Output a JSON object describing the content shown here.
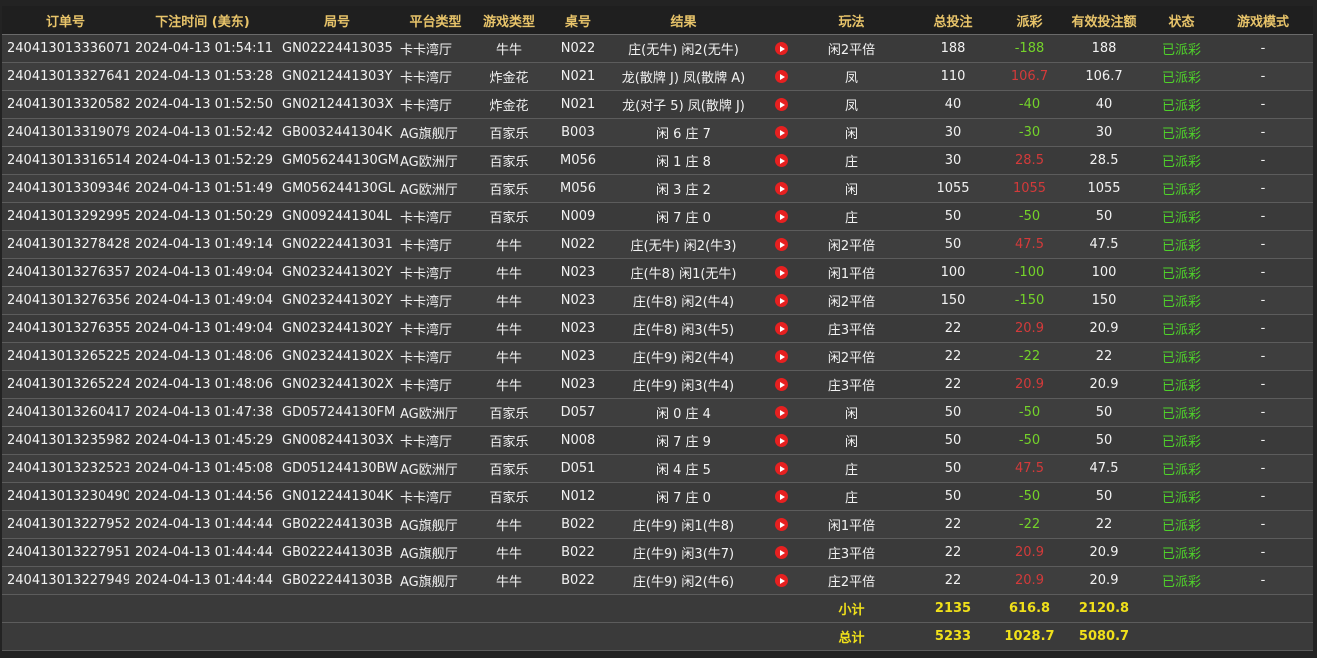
{
  "headers": [
    "订单号",
    "下注时间 (美东)",
    "局号",
    "平台类型",
    "游戏类型",
    "桌号",
    "结果",
    "玩法",
    "总投注",
    "派彩",
    "有效投注额",
    "状态",
    "游戏模式"
  ],
  "rows": [
    {
      "order": "240413013336071",
      "time": "2024-04-13 01:54:11",
      "round": "GN02224413035",
      "platform": "卡卡湾厅",
      "game": "牛牛",
      "table": "N022",
      "result": "庄(无牛) 闲2(无牛)",
      "play": "闲2平倍",
      "bet": "188",
      "payout": "-188",
      "payout_sign": "neg",
      "valid": "188",
      "status": "已派彩",
      "mode": "-"
    },
    {
      "order": "240413013327641",
      "time": "2024-04-13 01:53:28",
      "round": "GN0212441303Y",
      "platform": "卡卡湾厅",
      "game": "炸金花",
      "table": "N021",
      "result": "龙(散牌 J) 凤(散牌 A)",
      "play": "凤",
      "bet": "110",
      "payout": "106.7",
      "payout_sign": "pos",
      "valid": "106.7",
      "status": "已派彩",
      "mode": "-"
    },
    {
      "order": "240413013320582",
      "time": "2024-04-13 01:52:50",
      "round": "GN0212441303X",
      "platform": "卡卡湾厅",
      "game": "炸金花",
      "table": "N021",
      "result": "龙(对子 5) 凤(散牌 J)",
      "play": "凤",
      "bet": "40",
      "payout": "-40",
      "payout_sign": "neg",
      "valid": "40",
      "status": "已派彩",
      "mode": "-"
    },
    {
      "order": "240413013319079",
      "time": "2024-04-13 01:52:42",
      "round": "GB0032441304K",
      "platform": "AG旗舰厅",
      "game": "百家乐",
      "table": "B003",
      "result": "闲 6 庄 7",
      "play": "闲",
      "bet": "30",
      "payout": "-30",
      "payout_sign": "neg",
      "valid": "30",
      "status": "已派彩",
      "mode": "-"
    },
    {
      "order": "240413013316514",
      "time": "2024-04-13 01:52:29",
      "round": "GM056244130GM",
      "platform": "AG欧洲厅",
      "game": "百家乐",
      "table": "M056",
      "result": "闲 1 庄 8",
      "play": "庄",
      "bet": "30",
      "payout": "28.5",
      "payout_sign": "pos",
      "valid": "28.5",
      "status": "已派彩",
      "mode": "-"
    },
    {
      "order": "240413013309346",
      "time": "2024-04-13 01:51:49",
      "round": "GM056244130GL",
      "platform": "AG欧洲厅",
      "game": "百家乐",
      "table": "M056",
      "result": "闲 3 庄 2",
      "play": "闲",
      "bet": "1055",
      "payout": "1055",
      "payout_sign": "pos",
      "valid": "1055",
      "status": "已派彩",
      "mode": "-"
    },
    {
      "order": "240413013292995",
      "time": "2024-04-13 01:50:29",
      "round": "GN0092441304L",
      "platform": "卡卡湾厅",
      "game": "百家乐",
      "table": "N009",
      "result": "闲 7 庄 0",
      "play": "庄",
      "bet": "50",
      "payout": "-50",
      "payout_sign": "neg",
      "valid": "50",
      "status": "已派彩",
      "mode": "-"
    },
    {
      "order": "240413013278428",
      "time": "2024-04-13 01:49:14",
      "round": "GN02224413031",
      "platform": "卡卡湾厅",
      "game": "牛牛",
      "table": "N022",
      "result": "庄(无牛) 闲2(牛3)",
      "play": "闲2平倍",
      "bet": "50",
      "payout": "47.5",
      "payout_sign": "pos",
      "valid": "47.5",
      "status": "已派彩",
      "mode": "-"
    },
    {
      "order": "240413013276357",
      "time": "2024-04-13 01:49:04",
      "round": "GN0232441302Y",
      "platform": "卡卡湾厅",
      "game": "牛牛",
      "table": "N023",
      "result": "庄(牛8) 闲1(无牛)",
      "play": "闲1平倍",
      "bet": "100",
      "payout": "-100",
      "payout_sign": "neg",
      "valid": "100",
      "status": "已派彩",
      "mode": "-"
    },
    {
      "order": "240413013276356",
      "time": "2024-04-13 01:49:04",
      "round": "GN0232441302Y",
      "platform": "卡卡湾厅",
      "game": "牛牛",
      "table": "N023",
      "result": "庄(牛8) 闲2(牛4)",
      "play": "闲2平倍",
      "bet": "150",
      "payout": "-150",
      "payout_sign": "neg",
      "valid": "150",
      "status": "已派彩",
      "mode": "-"
    },
    {
      "order": "240413013276355",
      "time": "2024-04-13 01:49:04",
      "round": "GN0232441302Y",
      "platform": "卡卡湾厅",
      "game": "牛牛",
      "table": "N023",
      "result": "庄(牛8) 闲3(牛5)",
      "play": "庄3平倍",
      "bet": "22",
      "payout": "20.9",
      "payout_sign": "pos",
      "valid": "20.9",
      "status": "已派彩",
      "mode": "-"
    },
    {
      "order": "240413013265225",
      "time": "2024-04-13 01:48:06",
      "round": "GN0232441302X",
      "platform": "卡卡湾厅",
      "game": "牛牛",
      "table": "N023",
      "result": "庄(牛9) 闲2(牛4)",
      "play": "闲2平倍",
      "bet": "22",
      "payout": "-22",
      "payout_sign": "neg",
      "valid": "22",
      "status": "已派彩",
      "mode": "-"
    },
    {
      "order": "240413013265224",
      "time": "2024-04-13 01:48:06",
      "round": "GN0232441302X",
      "platform": "卡卡湾厅",
      "game": "牛牛",
      "table": "N023",
      "result": "庄(牛9) 闲3(牛4)",
      "play": "庄3平倍",
      "bet": "22",
      "payout": "20.9",
      "payout_sign": "pos",
      "valid": "20.9",
      "status": "已派彩",
      "mode": "-"
    },
    {
      "order": "240413013260417",
      "time": "2024-04-13 01:47:38",
      "round": "GD057244130FM",
      "platform": "AG欧洲厅",
      "game": "百家乐",
      "table": "D057",
      "result": "闲 0 庄 4",
      "play": "闲",
      "bet": "50",
      "payout": "-50",
      "payout_sign": "neg",
      "valid": "50",
      "status": "已派彩",
      "mode": "-"
    },
    {
      "order": "240413013235982",
      "time": "2024-04-13 01:45:29",
      "round": "GN0082441303X",
      "platform": "卡卡湾厅",
      "game": "百家乐",
      "table": "N008",
      "result": "闲 7 庄 9",
      "play": "闲",
      "bet": "50",
      "payout": "-50",
      "payout_sign": "neg",
      "valid": "50",
      "status": "已派彩",
      "mode": "-"
    },
    {
      "order": "240413013232523",
      "time": "2024-04-13 01:45:08",
      "round": "GD051244130BW",
      "platform": "AG欧洲厅",
      "game": "百家乐",
      "table": "D051",
      "result": "闲 4 庄 5",
      "play": "庄",
      "bet": "50",
      "payout": "47.5",
      "payout_sign": "pos",
      "valid": "47.5",
      "status": "已派彩",
      "mode": "-"
    },
    {
      "order": "240413013230490",
      "time": "2024-04-13 01:44:56",
      "round": "GN0122441304K",
      "platform": "卡卡湾厅",
      "game": "百家乐",
      "table": "N012",
      "result": "闲 7 庄 0",
      "play": "庄",
      "bet": "50",
      "payout": "-50",
      "payout_sign": "neg",
      "valid": "50",
      "status": "已派彩",
      "mode": "-"
    },
    {
      "order": "240413013227952",
      "time": "2024-04-13 01:44:44",
      "round": "GB0222441303B",
      "platform": "AG旗舰厅",
      "game": "牛牛",
      "table": "B022",
      "result": "庄(牛9) 闲1(牛8)",
      "play": "闲1平倍",
      "bet": "22",
      "payout": "-22",
      "payout_sign": "neg",
      "valid": "22",
      "status": "已派彩",
      "mode": "-"
    },
    {
      "order": "240413013227951",
      "time": "2024-04-13 01:44:44",
      "round": "GB0222441303B",
      "platform": "AG旗舰厅",
      "game": "牛牛",
      "table": "B022",
      "result": "庄(牛9) 闲3(牛7)",
      "play": "庄3平倍",
      "bet": "22",
      "payout": "20.9",
      "payout_sign": "pos",
      "valid": "20.9",
      "status": "已派彩",
      "mode": "-"
    },
    {
      "order": "240413013227949",
      "time": "2024-04-13 01:44:44",
      "round": "GB0222441303B",
      "platform": "AG旗舰厅",
      "game": "牛牛",
      "table": "B022",
      "result": "庄(牛9) 闲2(牛6)",
      "play": "庄2平倍",
      "bet": "22",
      "payout": "20.9",
      "payout_sign": "pos",
      "valid": "20.9",
      "status": "已派彩",
      "mode": "-"
    }
  ],
  "subtotal": {
    "label": "小计",
    "bet": "2135",
    "payout": "616.8",
    "valid": "2120.8"
  },
  "total": {
    "label": "总计",
    "bet": "5233",
    "payout": "1028.7",
    "valid": "5080.7"
  },
  "icons": {
    "video": "play-video-icon"
  },
  "colors": {
    "header_text": "#e8c46a",
    "negative": "#74d32a",
    "positive": "#d33a3a",
    "status": "#4fd12a",
    "footer_text": "#f0e01a"
  }
}
